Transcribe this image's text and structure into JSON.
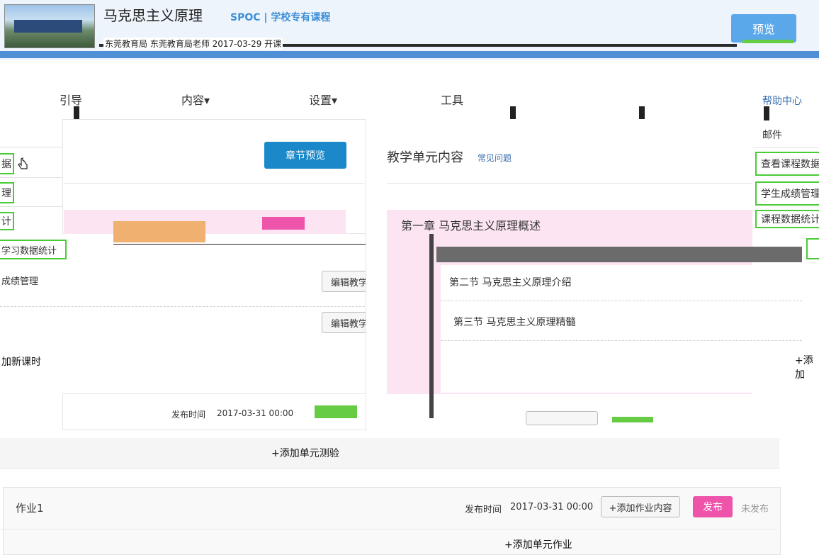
{
  "header": {
    "course_title": "马克思主义原理",
    "course_tag": "SPOC | 学校专有课程",
    "course_meta": "东莞教育局 东莞教育局老师 2017-03-29 开课",
    "preview_label": "预览"
  },
  "nav": {
    "items": [
      {
        "label": "引导"
      },
      {
        "label": "内容▾"
      },
      {
        "label": "设置▾"
      },
      {
        "label": "工具"
      },
      {
        "label": "帮助中心"
      }
    ]
  },
  "left_sidebar": {
    "items": [
      {
        "label": "据"
      },
      {
        "label": "理"
      },
      {
        "label": "计"
      },
      {
        "label": "学习数据统计"
      },
      {
        "label": "成绩管理"
      }
    ]
  },
  "middle_panel": {
    "chapter_preview_label": "章节预览",
    "edit_content_label_1": "编辑教学内容",
    "edit_content_label_2": "编辑教学内容",
    "add_lesson_label": "加新课时",
    "publish_time_label": "发布时间",
    "publish_time_value": "2017-03-31 00:00"
  },
  "teaching_panel": {
    "title": "教学单元内容",
    "faq_link": "常见问题",
    "chapter_title": "第一章 马克思主义原理概述",
    "sections": [
      {
        "label": "第二节 马克思主义原理介绍"
      },
      {
        "label": "第三节 马克思主义原理精髓"
      }
    ],
    "add_link": "+添加"
  },
  "right_sidebar": {
    "mail_label": "邮件",
    "items": [
      {
        "label": "查看课程数据"
      },
      {
        "label": "学生成绩管理"
      },
      {
        "label": "课程数据统计"
      }
    ]
  },
  "add_unit_test_label": "+添加单元测验",
  "homework": {
    "title": "作业1",
    "publish_time_label": "发布时间",
    "publish_time_value": "2017-03-31 00:00",
    "add_content_label": "+添加作业内容",
    "publish_label": "发布",
    "status_label": "未发布",
    "add_unit_homework_label": "+添加单元作业"
  },
  "colors": {
    "accent_blue": "#1a88c9",
    "light_blue": "#5aa8ea",
    "green_highlight": "#49cc36",
    "publish_pink": "#ee55aa",
    "pink_row": "#fce4f3"
  }
}
